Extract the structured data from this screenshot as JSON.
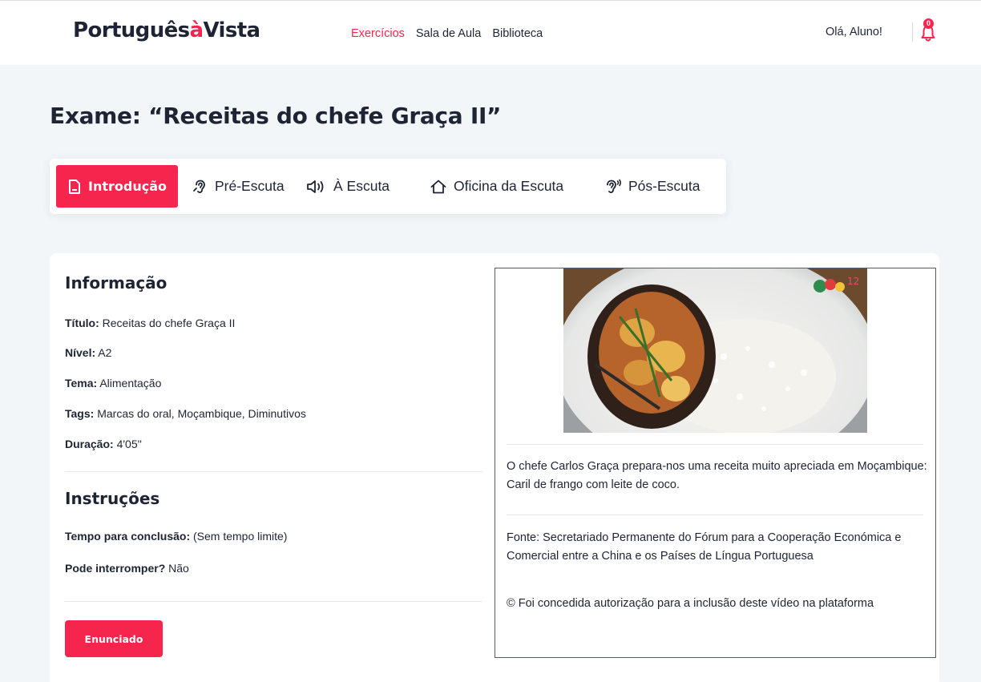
{
  "header": {
    "logo_main": "Português",
    "logo_accent": "à",
    "logo_end": "Vista",
    "nav": [
      {
        "label": "Exercícios",
        "active": true
      },
      {
        "label": "Sala de Aula",
        "active": false
      },
      {
        "label": "Biblioteca",
        "active": false
      }
    ],
    "greeting": "Olá, Aluno!",
    "notifications_count": "0"
  },
  "page": {
    "title": "Exame: “Receitas do chefe Graça II”"
  },
  "tabs": [
    {
      "label": "Introdução",
      "icon": "document-icon",
      "active": true
    },
    {
      "label": "Pré-Escuta",
      "icon": "ear-icon",
      "active": false
    },
    {
      "label": "À Escuta",
      "icon": "speaker-icon",
      "active": false
    },
    {
      "label": "Oficina da Escuta",
      "icon": "home-icon",
      "active": false
    },
    {
      "label": "Pós-Escuta",
      "icon": "ear-sound-icon",
      "active": false
    }
  ],
  "info": {
    "heading": "Informação",
    "titulo_label": "Título:",
    "titulo_value": " Receitas do chefe Graça II",
    "nivel_label": "Nível:",
    "nivel_value": " A2",
    "tema_label": "Tema:",
    "tema_value": " Alimentação",
    "tags_label": "Tags:",
    "tags_value": " Marcas do oral, Moçambique, Diminutivos",
    "duracao_label": "Duração:",
    "duracao_value": " 4'05''"
  },
  "instructions": {
    "heading": "Instruções",
    "tempo_label": "Tempo para conclusão:",
    "tempo_value": " (Sem tempo limite)",
    "interromper_label": "Pode interromper?",
    "interromper_value": " Não",
    "button_label": "Enunciado"
  },
  "media": {
    "description": "O chefe Carlos Graça prepara-nos uma receita muito apreciada em Moçambique: Caril de frango com leite de coco.",
    "source": "Fonte: Secretariado Permanente do Fórum para a Cooperação Económica e Comercial entre a China e os Países de Língua Portuguesa",
    "copyright": "© Foi concedida autorização para a inclusão deste vídeo na plataforma"
  },
  "colors": {
    "accent": "#f5254d",
    "text": "#1e2433",
    "background": "#f3f6f9"
  }
}
